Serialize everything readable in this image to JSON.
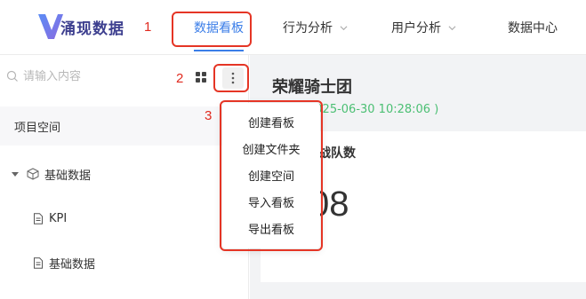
{
  "brand": {
    "logo_letter_icon": "v-logo-icon",
    "name": "涌现数据"
  },
  "annotations": [
    "1",
    "2",
    "3"
  ],
  "nav": {
    "items": [
      {
        "label": "数据看板",
        "active": true,
        "has_dropdown": false
      },
      {
        "label": "行为分析",
        "active": false,
        "has_dropdown": true
      },
      {
        "label": "用户分析",
        "active": false,
        "has_dropdown": true
      },
      {
        "label": "数据中心",
        "active": false,
        "has_dropdown": false
      }
    ],
    "active_color": "#3b7ee8"
  },
  "sidebar": {
    "search": {
      "placeholder": "请输入内容",
      "value": ""
    },
    "section_title": "项目空间",
    "tree": [
      {
        "label": "基础数据",
        "type": "folder",
        "expanded": true,
        "icon": "cube-icon"
      },
      {
        "label": "KPI",
        "type": "board",
        "icon": "document-icon"
      },
      {
        "label": "基础数据",
        "type": "board",
        "icon": "document-icon"
      }
    ]
  },
  "menu": {
    "items": [
      "创建看板",
      "创建文件夹",
      "创建空间",
      "导入看板",
      "导出看板"
    ]
  },
  "main": {
    "team_name": "荣耀骑士团",
    "updated_time": "2025-06-30 10:28:06 )",
    "card_title": "建战队数",
    "card_value": "08",
    "time_color": "#4bbf73"
  },
  "colors": {
    "annotation_red": "#e53525"
  }
}
